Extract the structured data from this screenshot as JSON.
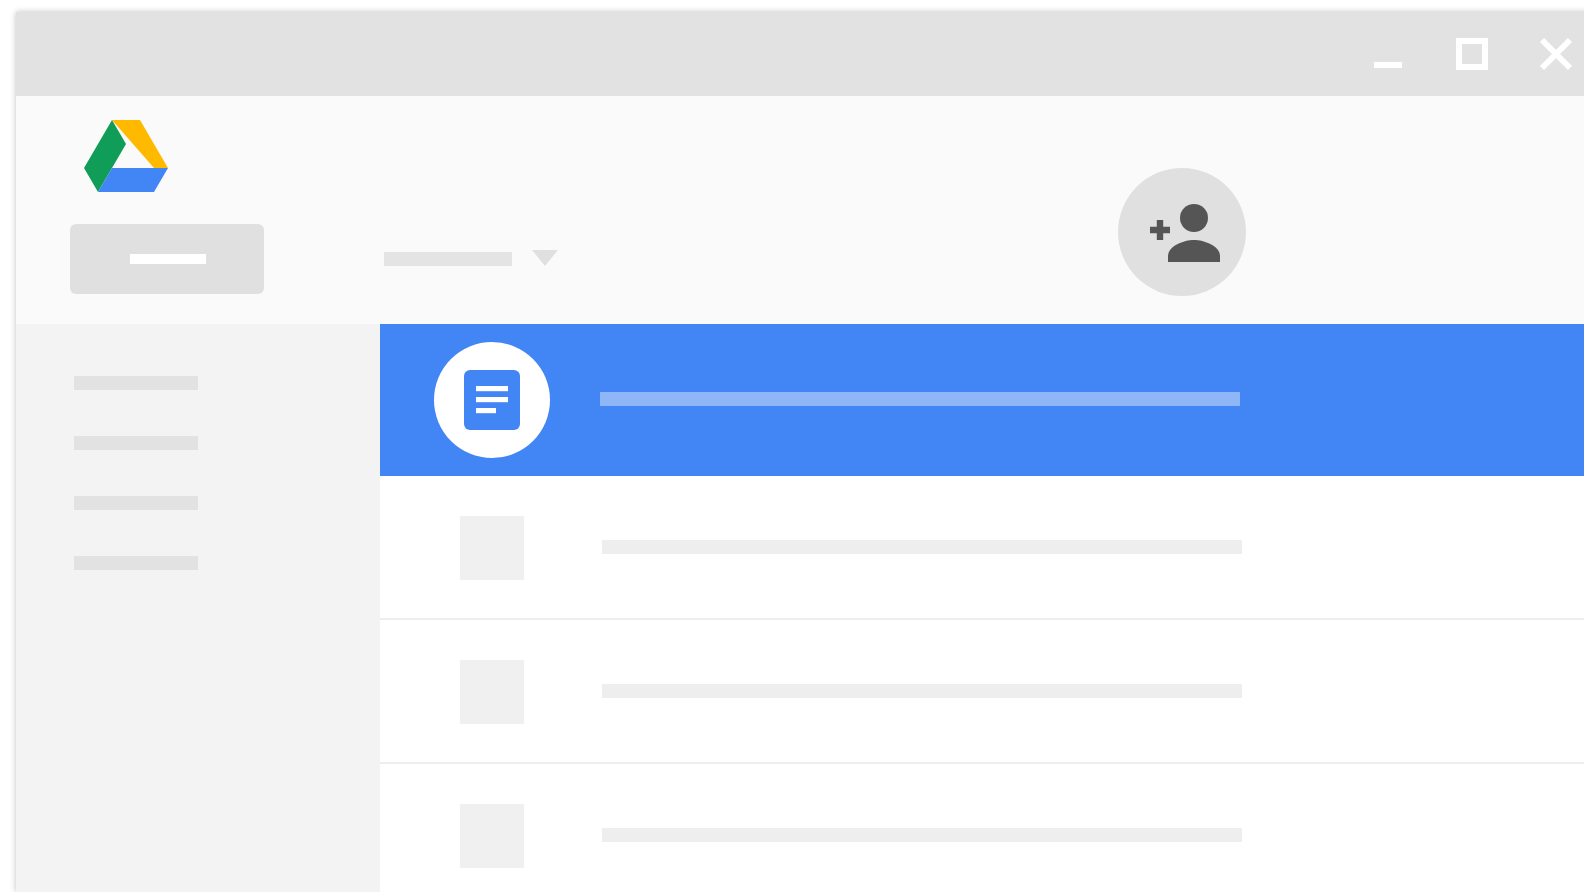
{
  "window_controls": [
    {
      "kind": "minimize"
    },
    {
      "kind": "maximize"
    },
    {
      "kind": "close"
    }
  ],
  "sidebar_items": [
    {
      "kind": "line"
    },
    {
      "kind": "line"
    },
    {
      "kind": "line"
    },
    {
      "kind": "line"
    }
  ],
  "rows": [
    {
      "kind": "document",
      "selected": true
    },
    {
      "kind": "blank",
      "selected": false
    },
    {
      "kind": "blank",
      "selected": false
    },
    {
      "kind": "blank",
      "selected": false
    }
  ]
}
